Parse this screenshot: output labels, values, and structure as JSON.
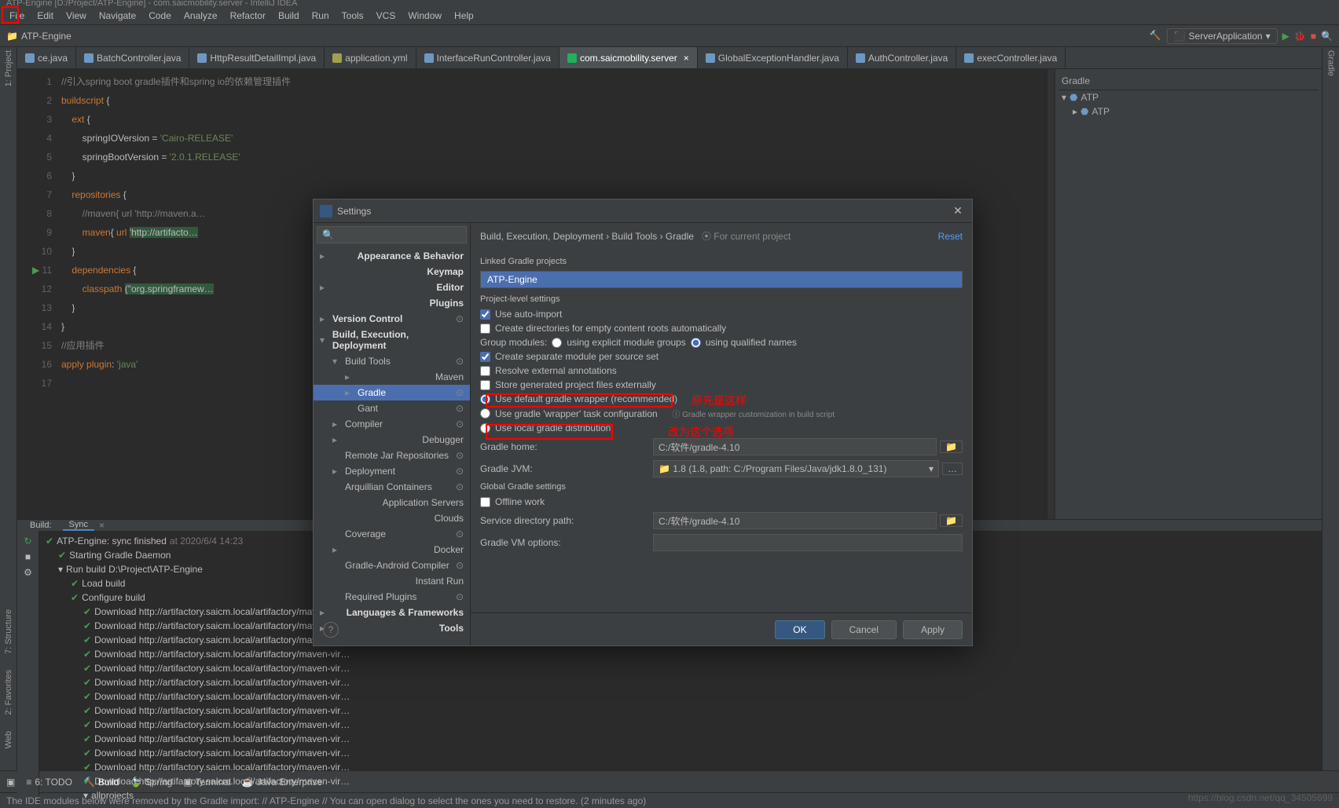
{
  "window": {
    "title": "ATP-Engine [D:/Project/ATP-Engine] - com.saicmobility.server - IntelliJ IDEA"
  },
  "menu": [
    "File",
    "Edit",
    "View",
    "Navigate",
    "Code",
    "Analyze",
    "Refactor",
    "Build",
    "Run",
    "Tools",
    "VCS",
    "Window",
    "Help"
  ],
  "breadcrumb": {
    "folder_icon": "📁",
    "project": "ATP-Engine"
  },
  "run_config": {
    "label": "ServerApplication",
    "chev": "▾"
  },
  "tool_windows_left": [
    "1: Project"
  ],
  "tool_windows_left_bottom": [
    "2: Favorites",
    "7: Structure"
  ],
  "tool_windows_left_web": "Web",
  "right_strip": "Gradle",
  "tabs": [
    {
      "name": "ce.java",
      "active": false,
      "icon": "j"
    },
    {
      "name": "BatchController.java",
      "active": false,
      "icon": "j"
    },
    {
      "name": "HttpResultDetailImpl.java",
      "active": false,
      "icon": "j"
    },
    {
      "name": "application.yml",
      "active": false,
      "icon": "y"
    },
    {
      "name": "InterfaceRunController.java",
      "active": false,
      "icon": "j"
    },
    {
      "name": "com.saicmobility.server",
      "active": true,
      "icon": "g"
    },
    {
      "name": "GlobalExceptionHandler.java",
      "active": false,
      "icon": "j"
    },
    {
      "name": "AuthController.java",
      "active": false,
      "icon": "j"
    },
    {
      "name": "execController.java",
      "active": false,
      "icon": "j"
    }
  ],
  "editor": {
    "lines": [
      "//引入spring boot gradle插件和spring io的依赖管理插件",
      "buildscript {",
      "    ext {",
      "        springIOVersion = 'Cairo-RELEASE'",
      "        springBootVersion = '2.0.1.RELEASE'",
      "    }",
      "    repositories {",
      "        //maven{ url 'http://maven.a…",
      "        maven{ url 'http://artifacto…",
      "    }",
      "    dependencies {",
      "        classpath (\"org.springframew…",
      "    }",
      "}",
      "",
      "//应用插件",
      "apply plugin: 'java'"
    ]
  },
  "right_tree": {
    "title": "Gradle",
    "root": "ATP",
    "items": [
      "ATP"
    ]
  },
  "build": {
    "tabs": [
      "Build:",
      "Sync"
    ],
    "root": "ATP-Engine: sync finished",
    "root_time": "at 2020/6/4 14:23",
    "nodes": [
      "Starting Gradle Daemon",
      "Run build D:\\Project\\ATP-Engine",
      "Load build",
      "Configure build"
    ],
    "downloads_prefix": "Download http://artifactory.saicm.local/artifactory/maven-vir…",
    "last": "allprojects"
  },
  "bottom_tools": [
    {
      "icon": "≡",
      "label": "6: TODO"
    },
    {
      "icon": "🔨",
      "label": "Build",
      "active": true
    },
    {
      "icon": "🍃",
      "label": "Spring"
    },
    {
      "icon": "▣",
      "label": "Terminal"
    },
    {
      "icon": "☕",
      "label": "Java Enterprise"
    }
  ],
  "status": {
    "msg": "The IDE modules below were removed by the Gradle import: // ATP-Engine // You can open dialog to select the ones you need to restore. (2 minutes ago)"
  },
  "dialog": {
    "title": "Settings",
    "search_placeholder": "",
    "search_icon": "🔍",
    "tree": [
      {
        "t": "Appearance & Behavior",
        "lvl": 0,
        "bold": true,
        "chev": "▸"
      },
      {
        "t": "Keymap",
        "lvl": 0,
        "bold": true
      },
      {
        "t": "Editor",
        "lvl": 0,
        "bold": true,
        "chev": "▸"
      },
      {
        "t": "Plugins",
        "lvl": 0,
        "bold": true
      },
      {
        "t": "Version Control",
        "lvl": 0,
        "bold": true,
        "chev": "▸",
        "gear": true
      },
      {
        "t": "Build, Execution, Deployment",
        "lvl": 0,
        "bold": true,
        "chev": "▾"
      },
      {
        "t": "Build Tools",
        "lvl": 1,
        "bold": false,
        "chev": "▾",
        "gear": true
      },
      {
        "t": "Maven",
        "lvl": 2,
        "bold": false,
        "chev": "▸"
      },
      {
        "t": "Gradle",
        "lvl": 2,
        "bold": false,
        "chev": "▸",
        "sel": true,
        "gear": true
      },
      {
        "t": "Gant",
        "lvl": 2,
        "bold": false,
        "gear": true
      },
      {
        "t": "Compiler",
        "lvl": 1,
        "bold": false,
        "chev": "▸",
        "gear": true
      },
      {
        "t": "Debugger",
        "lvl": 1,
        "bold": false,
        "chev": "▸"
      },
      {
        "t": "Remote Jar Repositories",
        "lvl": 1,
        "bold": false,
        "gear": true
      },
      {
        "t": "Deployment",
        "lvl": 1,
        "bold": false,
        "chev": "▸",
        "gear": true
      },
      {
        "t": "Arquillian Containers",
        "lvl": 1,
        "bold": false,
        "gear": true
      },
      {
        "t": "Application Servers",
        "lvl": 1,
        "bold": false
      },
      {
        "t": "Clouds",
        "lvl": 1,
        "bold": false
      },
      {
        "t": "Coverage",
        "lvl": 1,
        "bold": false,
        "gear": true
      },
      {
        "t": "Docker",
        "lvl": 1,
        "bold": false,
        "chev": "▸"
      },
      {
        "t": "Gradle-Android Compiler",
        "lvl": 1,
        "bold": false,
        "gear": true
      },
      {
        "t": "Instant Run",
        "lvl": 1,
        "bold": false
      },
      {
        "t": "Required Plugins",
        "lvl": 1,
        "bold": false,
        "gear": true
      },
      {
        "t": "Languages & Frameworks",
        "lvl": 0,
        "bold": true,
        "chev": "▸"
      },
      {
        "t": "Tools",
        "lvl": 0,
        "bold": true,
        "chev": "▸"
      }
    ],
    "crumb": "Build, Execution, Deployment  ›  Build Tools  ›  Gradle",
    "for_project": "⦿ For current project",
    "reset": "Reset",
    "linked_label": "Linked Gradle projects",
    "linked_item": "ATP-Engine",
    "pl_label": "Project-level settings",
    "cb_auto": "Use auto-import",
    "cb_dirs": "Create directories for empty content roots automatically",
    "grp_label": "Group modules:",
    "grp_a": "using explicit module groups",
    "grp_b": "using qualified names",
    "cb_sep": "Create separate module per source set",
    "cb_res": "Resolve external annotations",
    "cb_ext": "Store generated project files externally",
    "rb_def": "Use default gradle wrapper (recommended)",
    "rb_wrap": "Use gradle 'wrapper' task configuration",
    "wrap_hint": "ⓘ Gradle wrapper customization in build script",
    "rb_local": "Use local gradle distribution",
    "gradle_home_l": "Gradle home:",
    "gradle_home_v": "C:/软件/gradle-4.10",
    "gradle_jvm_l": "Gradle JVM:",
    "gradle_jvm_v": "1.8  (1.8, path: C:/Program Files/Java/jdk1.8.0_131)",
    "global_l": "Global Gradle settings",
    "offline": "Offline work",
    "svc_dir_l": "Service directory path:",
    "svc_dir_v": "C:/软件/gradle-4.10",
    "vm_l": "Gradle VM options:",
    "btn_ok": "OK",
    "btn_cancel": "Cancel",
    "btn_apply": "Apply",
    "help": "?",
    "close": "✕"
  },
  "annotations": {
    "a1": "原先是这样",
    "a2": "改为这个选项"
  },
  "watermark": "https://blog.csdn.net/qq_34505699"
}
